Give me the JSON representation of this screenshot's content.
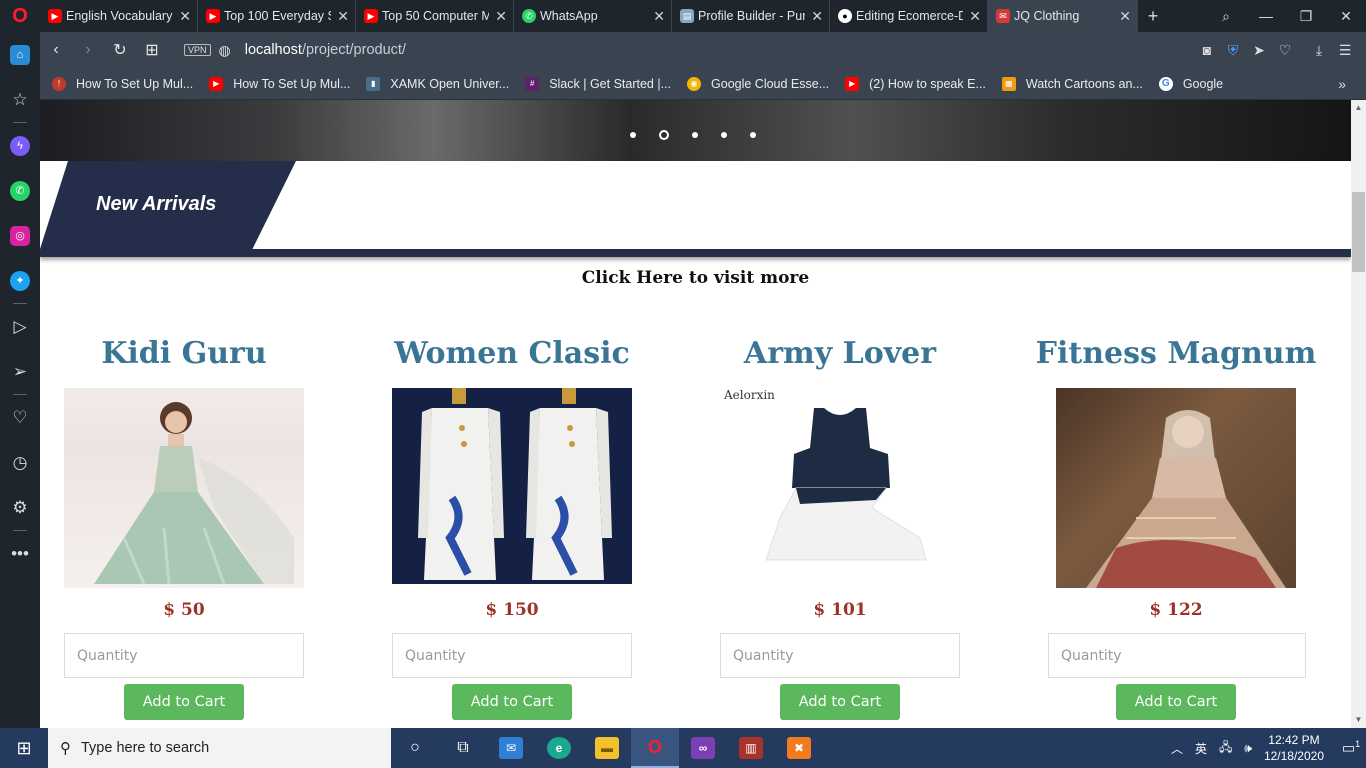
{
  "browser": {
    "tabs": [
      {
        "title": "English Vocabulary Si",
        "icon": "youtube-icon",
        "color": "#ff0000"
      },
      {
        "title": "Top 100 Everyday Se",
        "icon": "youtube-icon",
        "color": "#ff0000"
      },
      {
        "title": "Top 50 Computer M",
        "icon": "youtube-icon",
        "color": "#ff0000"
      },
      {
        "title": "WhatsApp",
        "icon": "whatsapp-icon",
        "color": "#25d366"
      },
      {
        "title": "Profile Builder - Pur",
        "icon": "document-icon",
        "color": "#8aa6c1"
      },
      {
        "title": "Editing Ecomerce-D",
        "icon": "github-icon",
        "color": "#ffffff"
      },
      {
        "title": "JQ Clothing",
        "icon": "site-icon",
        "color": "#d33b3b"
      }
    ],
    "new_tab_symbol": "+",
    "url_host": "localhost",
    "url_path": "/project/product/",
    "vpn_label": "VPN",
    "bookmarks": [
      {
        "title": "How To Set Up Mul...",
        "icon": "bookmark-site-icon",
        "color": "#c0392b"
      },
      {
        "title": "How To Set Up Mul...",
        "icon": "youtube-icon",
        "color": "#ff0000"
      },
      {
        "title": "XAMK Open Univer...",
        "icon": "xamk-icon",
        "color": "#4a6d8c"
      },
      {
        "title": "Slack | Get Started |...",
        "icon": "slack-icon",
        "color": "#611f69"
      },
      {
        "title": "Google Cloud Esse...",
        "icon": "qwiklabs-icon",
        "color": "#f4b400"
      },
      {
        "title": "(2) How to speak E...",
        "icon": "youtube-icon",
        "color": "#ff0000"
      },
      {
        "title": "Watch Cartoons an...",
        "icon": "cartoon-site-icon",
        "color": "#f39c12"
      },
      {
        "title": "Google",
        "icon": "google-icon",
        "color": "#4285f4"
      }
    ]
  },
  "page": {
    "section_title": "New Arrivals",
    "visit_more": "Click Here to visit more",
    "quantity_placeholder": "Quantity",
    "add_to_cart": "Add to Cart",
    "products": [
      {
        "name": "Kidi Guru",
        "price": "$ 50"
      },
      {
        "name": "Women Clasic",
        "price": "$ 150"
      },
      {
        "name": "Army Lover",
        "price": "$ 101",
        "image_label": "Aelorxin"
      },
      {
        "name": "Fitness Magnum",
        "price": "$ 122"
      }
    ]
  },
  "taskbar": {
    "search_placeholder": "Type here to search",
    "time": "12:42 PM",
    "date": "12/18/2020",
    "notification_count": "1"
  }
}
